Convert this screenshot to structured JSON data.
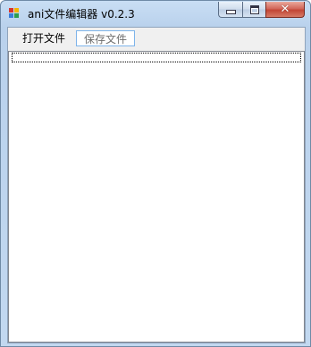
{
  "window": {
    "title": "ani文件编辑器 v0.2.3",
    "controls": {
      "minimize_icon": "minimize-icon",
      "maximize_icon": "maximize-icon",
      "close_icon": "close-icon",
      "close_glyph": "✕"
    }
  },
  "menubar": {
    "items": [
      {
        "label": "打开文件",
        "state": "normal"
      },
      {
        "label": "保存文件",
        "state": "hover-disabled"
      }
    ]
  },
  "editor": {
    "value": ""
  },
  "colors": {
    "frame": "#b9d1ec",
    "close_button": "#c24535",
    "menu_highlight_border": "#7eb4ea",
    "disabled_text": "#6d6d6d"
  }
}
